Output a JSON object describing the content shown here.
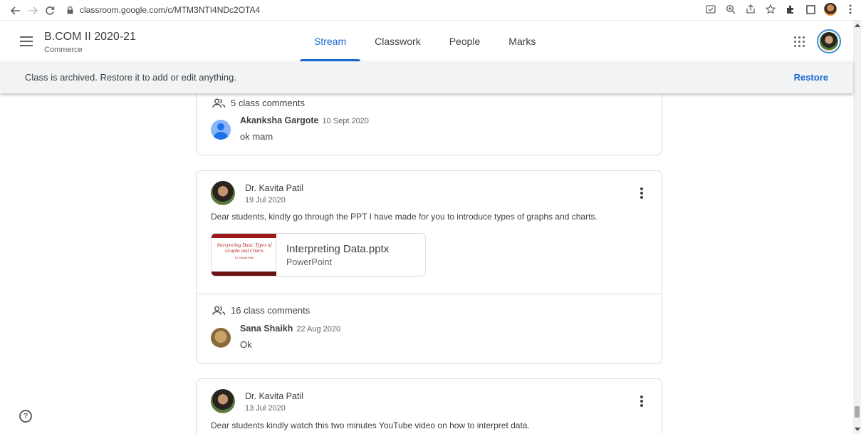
{
  "browser": {
    "url": "classroom.google.com/c/MTM3NTI4NDc2OTA4",
    "icons": [
      "back-icon",
      "forward-icon",
      "reload-icon",
      "lock-icon",
      "cast-icon",
      "zoom-icon",
      "share-icon",
      "star-icon",
      "extensions-icon",
      "sidepanel-icon",
      "profile-icon",
      "more-icon"
    ]
  },
  "header": {
    "class_title": "B.COM II 2020-21",
    "class_subtitle": "Commerce",
    "tabs": [
      {
        "label": "Stream",
        "active": true
      },
      {
        "label": "Classwork",
        "active": false
      },
      {
        "label": "People",
        "active": false
      },
      {
        "label": "Marks",
        "active": false
      }
    ]
  },
  "banner": {
    "text": "Class is archived. Restore it to add or edit anything.",
    "restore_label": "Restore"
  },
  "posts": [
    {
      "comments_count_label": "5 class comments",
      "comment": {
        "author": "Akanksha Gargote",
        "date": "10 Sept 2020",
        "text": "ok mam"
      }
    },
    {
      "author": "Dr. Kavita Patil",
      "date": "19 Jul 2020",
      "text": "Dear students, kindly go through the PPT I have made for you to introduce types of graphs and charts.",
      "attachment": {
        "name": "Interpreting Data.pptx",
        "type": "PowerPoint",
        "thumb_title": "Interpreting Data: Types of Graphs and Charts",
        "thumb_sub": "Dr. Kavita Patil"
      },
      "comments_count_label": "16 class comments",
      "comment": {
        "author": "Sana Shaikh",
        "date": "22 Aug 2020",
        "text": "Ok"
      }
    },
    {
      "author": "Dr. Kavita Patil",
      "date": "13 Jul 2020",
      "text": "Dear students kindly watch this two minutes YouTube video on how to interpret data."
    }
  ],
  "colors": {
    "accent": "#1967d2",
    "banner_bg": "#f1f3f4",
    "border": "#dadce0"
  }
}
